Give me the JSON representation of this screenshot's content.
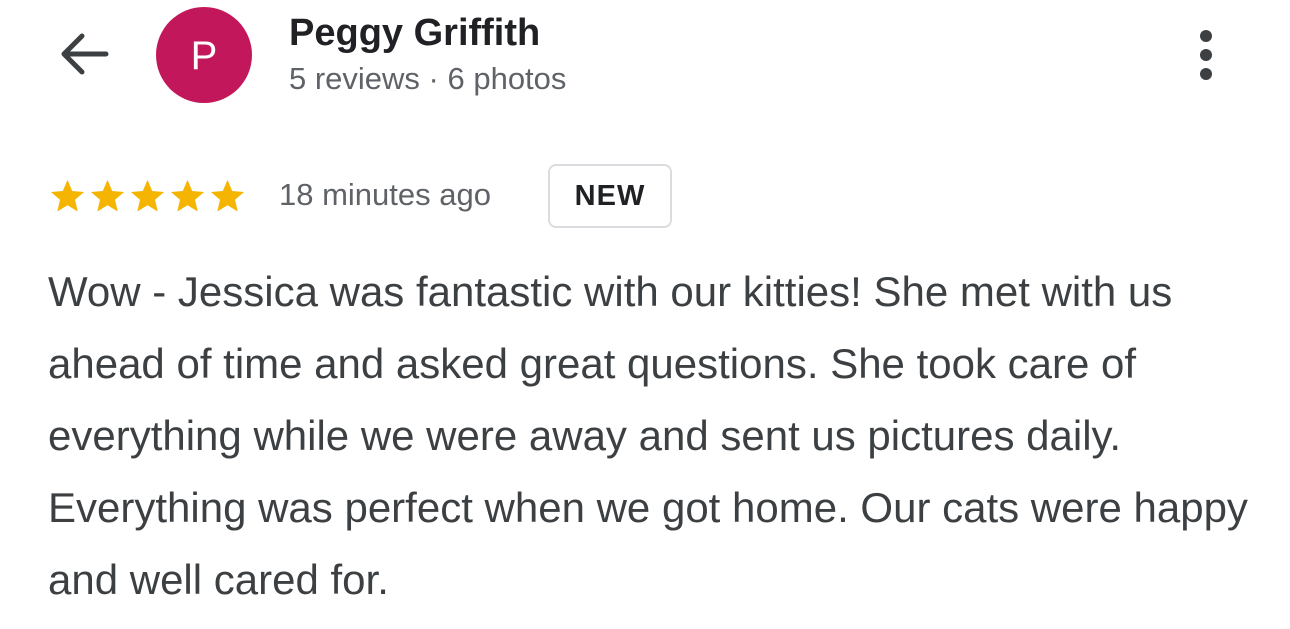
{
  "header": {
    "back_icon": "arrow-back-icon",
    "avatar_letter": "P",
    "avatar_color": "#c2185b",
    "reviewer_name": "Peggy Griffith",
    "reviewer_meta": "5 reviews · 6 photos",
    "more_icon": "more-vert-icon"
  },
  "review": {
    "rating": 5,
    "rating_max": 5,
    "star_color": "#f4b400",
    "time_ago": "18 minutes ago",
    "badge": "NEW",
    "text": "Wow - Jessica was fantastic with our kitties! She met with us ahead of time and asked great questions. She took care of everything while we were away and sent us pictures daily. Everything was perfect when we got home. Our cats were happy and well cared for."
  }
}
